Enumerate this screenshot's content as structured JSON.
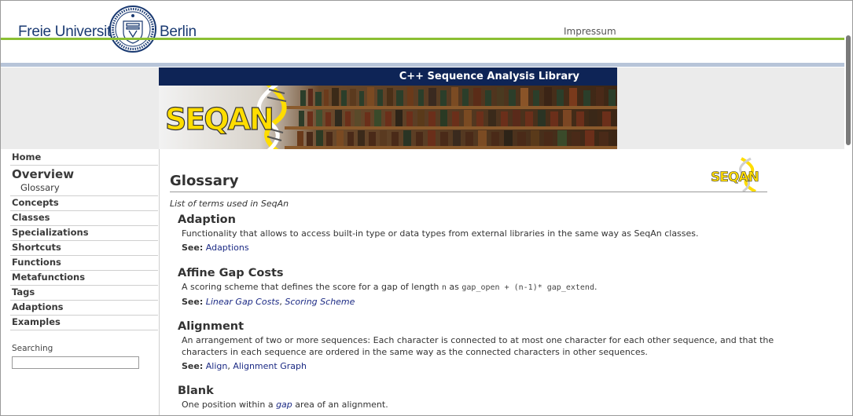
{
  "header": {
    "brand_left": "Freie Universität",
    "brand_right": "Berlin",
    "seal_icon": "university-seal-icon",
    "impressum": "Impressum",
    "colors": {
      "green": "#8bbf33",
      "blue_line": "#b7c4d8",
      "navy": "#0e2456"
    }
  },
  "banner": {
    "title": "C++ Sequence Analysis Library",
    "logo_text": "SEQAN"
  },
  "sidebar": {
    "home": "Home",
    "overview": "Overview",
    "overview_sub": "Glossary",
    "items": [
      "Concepts",
      "Classes",
      "Specializations",
      "Shortcuts",
      "Functions",
      "Metafunctions",
      "Tags",
      "Adaptions",
      "Examples"
    ],
    "search_label": "Searching",
    "search_value": ""
  },
  "main": {
    "title": "Glossary",
    "subtitle": "List of terms used in SeqAn",
    "logo_text": "SEQAN",
    "see_label": "See:",
    "entries": [
      {
        "term": "Adaption",
        "desc": "Functionality that allows to access built-in type or data types from external libraries in the same way as SeqAn classes.",
        "see": [
          "Adaptions"
        ]
      },
      {
        "term": "Affine Gap Costs",
        "desc_prefix": "A scoring scheme that defines the score for a gap of length",
        "desc_var": "n",
        "desc_mid": "as",
        "desc_code": "gap_open + (n-1)* gap_extend",
        "desc_suffix": ".",
        "see": [
          "Linear Gap Costs",
          "Scoring Scheme"
        ],
        "see_sep": ","
      },
      {
        "term": "Alignment",
        "desc": "An arrangement of two or more sequences: Each character is connected to at most one character for each other sequence, and that the characters in each sequence are ordered in the same way as the connected characters in other sequences.",
        "see": [
          "Align",
          "Alignment Graph"
        ],
        "see_sep": ","
      },
      {
        "term": "Blank",
        "desc_prefix": "One position within a",
        "desc_link": "gap",
        "desc_suffix": "area of an alignment."
      }
    ]
  }
}
